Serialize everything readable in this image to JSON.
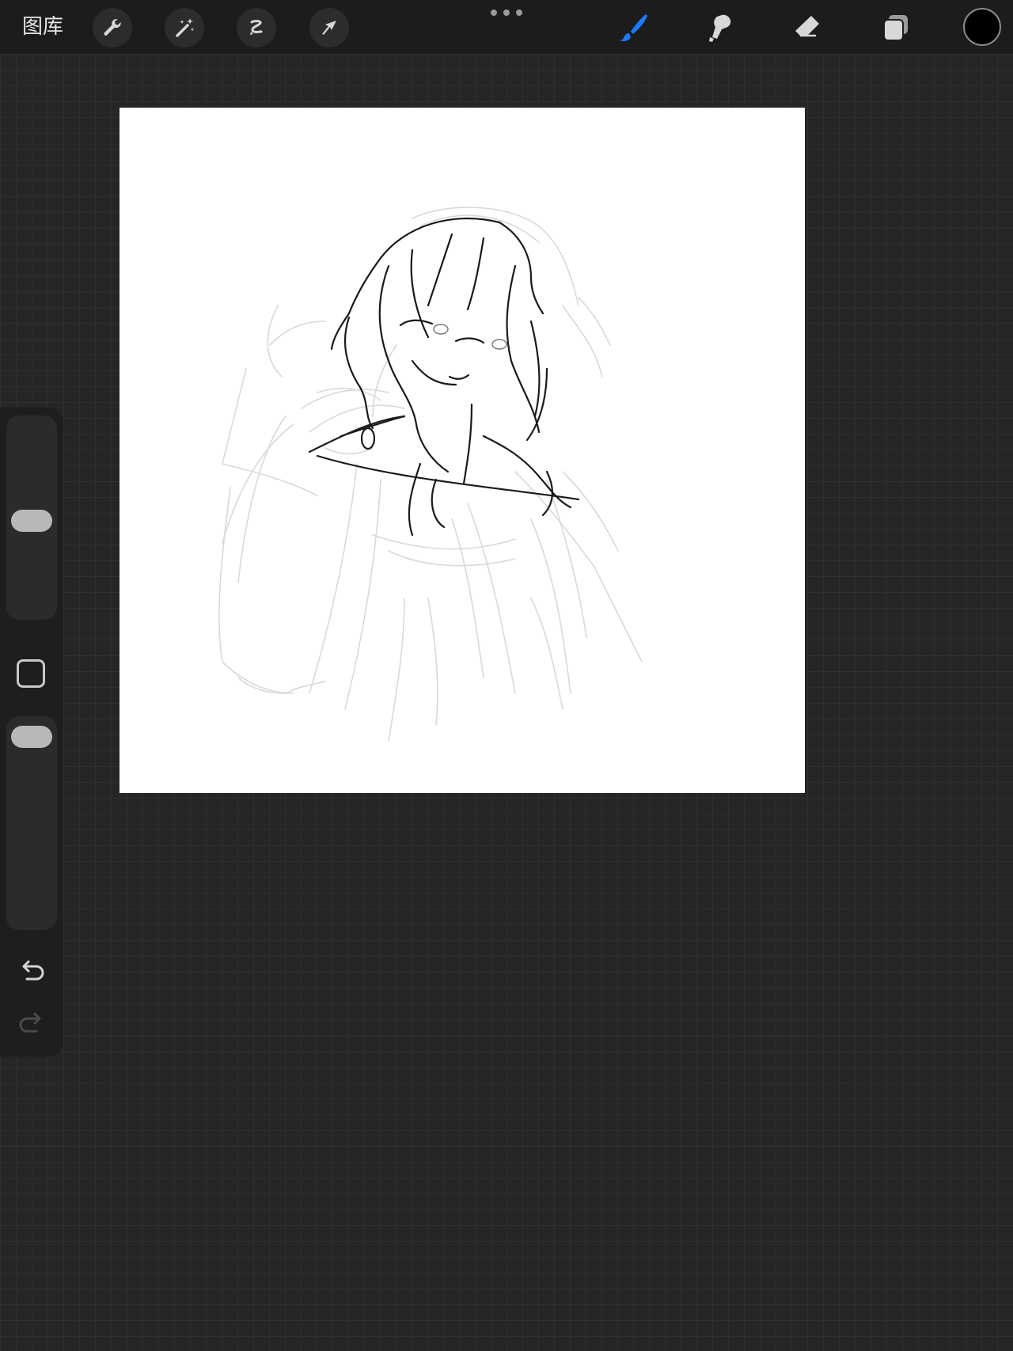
{
  "topbar": {
    "gallery_label": "图库",
    "tools_left": [
      {
        "name": "wrench-icon"
      },
      {
        "name": "magic-wand-icon"
      },
      {
        "name": "selection-icon"
      },
      {
        "name": "transform-arrow-icon"
      }
    ],
    "tools_right": [
      {
        "name": "brush-icon",
        "active": true
      },
      {
        "name": "smudge-icon"
      },
      {
        "name": "eraser-icon"
      },
      {
        "name": "layers-icon"
      }
    ],
    "current_color": "#000000",
    "accent_color": "#1a7cff"
  },
  "sidebar": {
    "brush_size_level": 0.52,
    "opacity_level": 0.12,
    "icons": [
      "modify-square-icon",
      "undo-icon",
      "redo-icon"
    ]
  }
}
